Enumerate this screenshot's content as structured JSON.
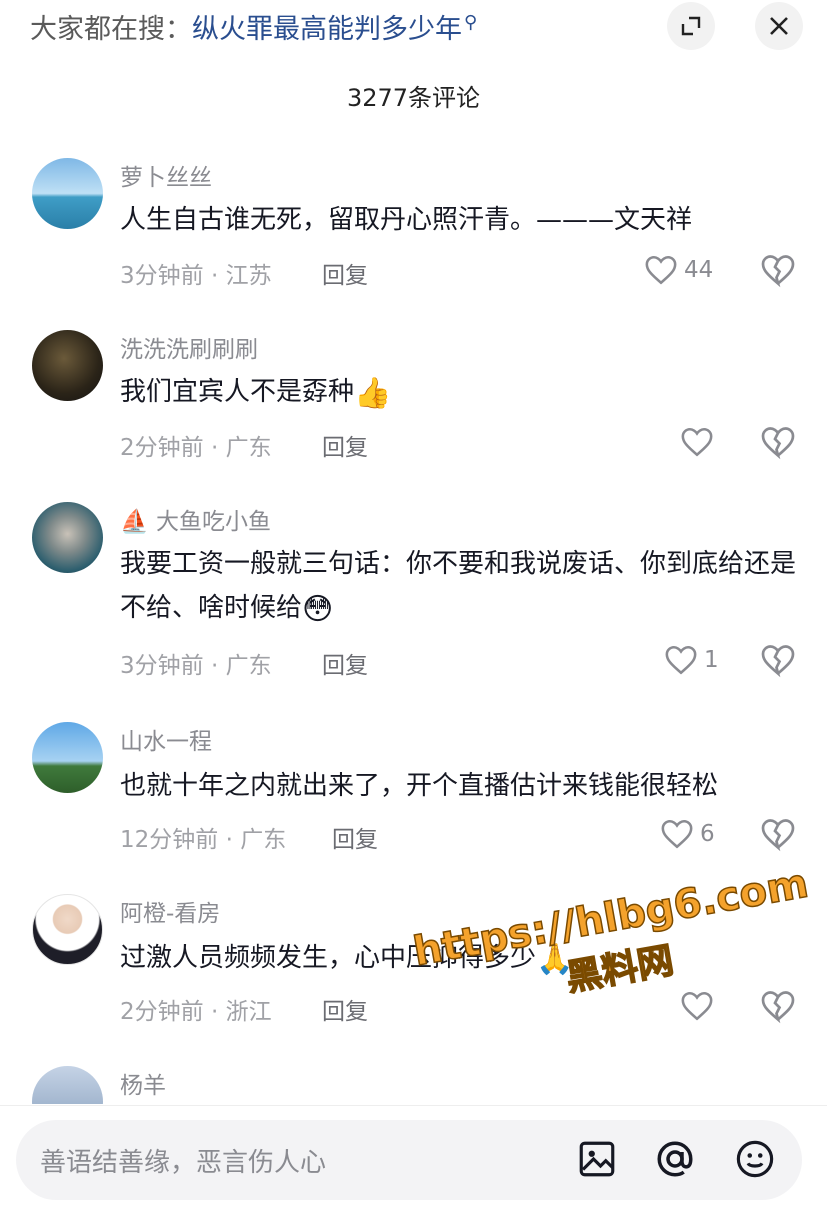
{
  "search": {
    "prefix": "大家都在搜：",
    "query": "纵火罪最高能判多少年",
    "query_icon": "search-icon"
  },
  "header": {
    "title": "3277条评论"
  },
  "comments": [
    {
      "username": "萝卜丝丝",
      "text": "人生自古谁无死，留取丹心照汗青。———文天祥",
      "time": "3分钟前",
      "location": "江苏",
      "reply": "回复",
      "likes": "44"
    },
    {
      "username": "洗洗洗刷刷刷",
      "text": "我们宜宾人不是孬种",
      "emoji": "👍",
      "time": "2分钟前",
      "location": "广东",
      "reply": "回复",
      "likes": ""
    },
    {
      "username": "大鱼吃小鱼",
      "badge": "⛵",
      "text": "我要工资一般就三句话：你不要和我说废话、你到底给还是不给、啥时候给",
      "emoji": "😳",
      "time": "3分钟前",
      "location": "广东",
      "reply": "回复",
      "likes": "1"
    },
    {
      "username": "山水一程",
      "text": "也就十年之内就出来了，开个直播估计来钱能很轻松",
      "time": "12分钟前",
      "location": "广东",
      "reply": "回复",
      "likes": "6"
    },
    {
      "username": "阿橙-看房",
      "text": "过激人员频频发生，心中压抑得多少",
      "emoji": "🙏",
      "time": "2分钟前",
      "location": "浙江",
      "reply": "回复",
      "likes": ""
    },
    {
      "username": "杨羊"
    }
  ],
  "input": {
    "placeholder": "善语结善缘，恶言伤人心"
  },
  "watermark": {
    "url": "https://hlbg6.com",
    "name": "黑料网"
  },
  "colors": {
    "link": "#2a4e8f",
    "meta": "#a0a1a6",
    "watermark": "#f4a22c"
  }
}
